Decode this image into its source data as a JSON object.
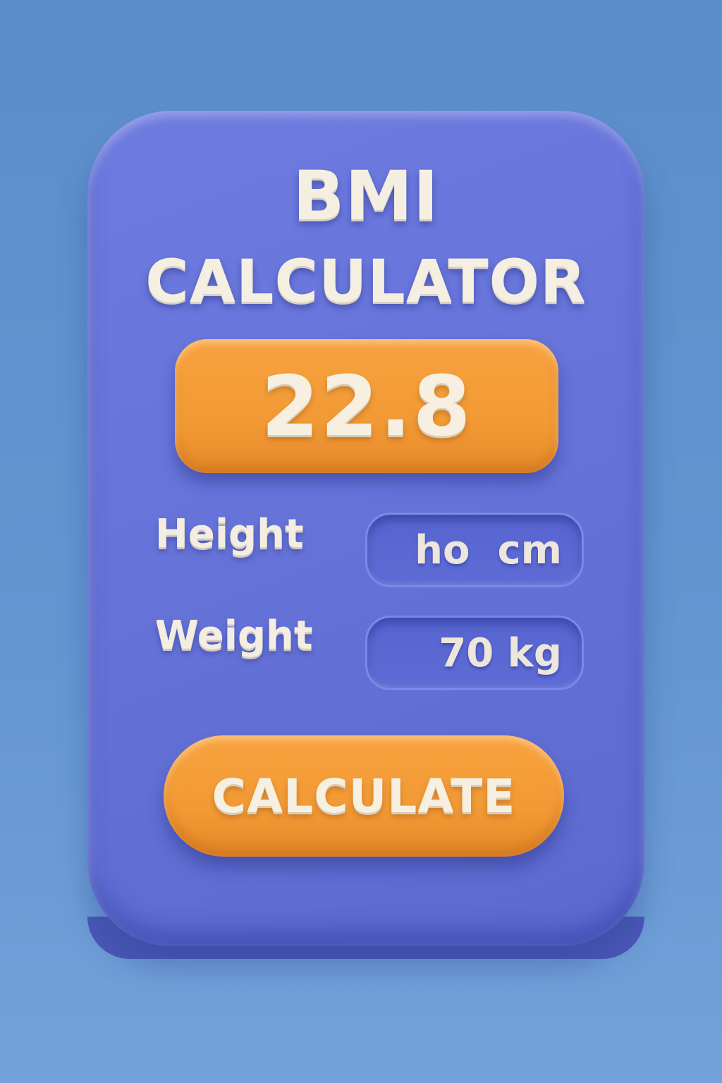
{
  "app": {
    "title_line1": "BMI",
    "title_line2": "CALCULATOR"
  },
  "result": {
    "value": "22.8"
  },
  "fields": {
    "height": {
      "label": "Height",
      "value": "ho  cm"
    },
    "weight": {
      "label": "Weight",
      "value": "70 kg"
    }
  },
  "actions": {
    "calculate_label": "CALCULATE"
  },
  "colors": {
    "background": "#6496d2",
    "card": "#6673d9",
    "accent": "#f29a35",
    "text": "#f5efe2"
  }
}
